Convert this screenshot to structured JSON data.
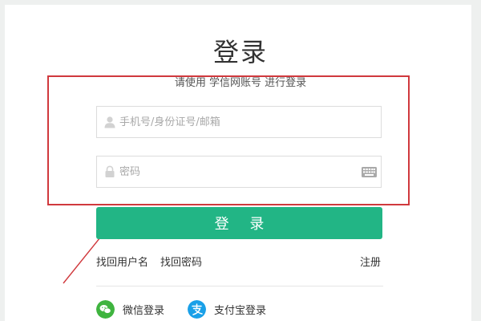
{
  "login": {
    "title": "登录",
    "subtitle": "请使用 学信网账号 进行登录",
    "username_placeholder": "手机号/身份证号/邮箱",
    "password_placeholder": "密码",
    "submit_label": "登 录"
  },
  "links": {
    "find_username": "找回用户名",
    "find_password": "找回密码",
    "register": "注册"
  },
  "social": {
    "wechat_label": "微信登录",
    "alipay_label": "支付宝登录"
  },
  "colors": {
    "accent_green": "#22b585",
    "annotation_red": "#d0393d",
    "wechat": "#3fb43f",
    "alipay": "#1aa0e8"
  },
  "icons": {
    "username": "user-icon",
    "password": "lock-icon",
    "keyboard": "keyboard-icon",
    "wechat": "wechat-icon",
    "alipay": "alipay-icon"
  }
}
